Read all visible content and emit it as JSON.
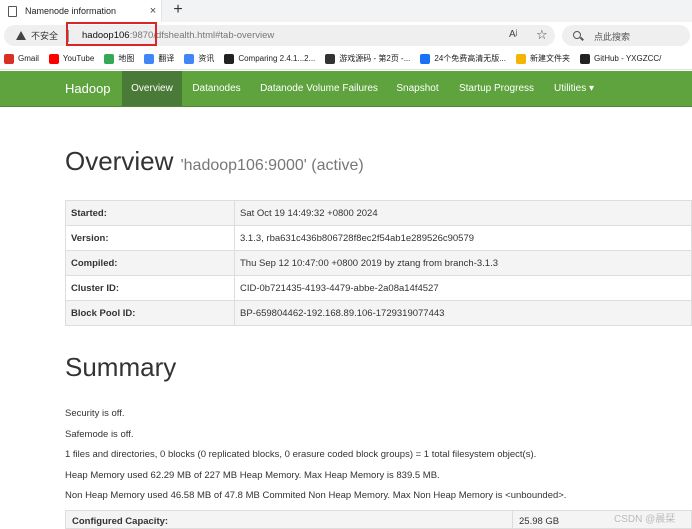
{
  "browser": {
    "tab_title": "Namenode information",
    "tab_close": "×",
    "new_tab": "+",
    "security_label": "不安全",
    "url_host": "hadoop106",
    "url_rest": ":9870/dfshealth.html#tab-overview",
    "read_aloud": "Aʲ",
    "favorite": "☆",
    "search_placeholder": "点此搜索"
  },
  "bookmarks": [
    {
      "label": "Gmail",
      "icon": "gmail-icon",
      "color": "#d93025"
    },
    {
      "label": "YouTube",
      "icon": "youtube-icon",
      "color": "#ff0000"
    },
    {
      "label": "地图",
      "icon": "maps-icon",
      "color": "#34a853"
    },
    {
      "label": "翻译",
      "icon": "translate-icon",
      "color": "#4285f4"
    },
    {
      "label": "资讯",
      "icon": "news-icon",
      "color": "#4285f4"
    },
    {
      "label": "Comparing 2.4.1...2...",
      "icon": "github-icon",
      "color": "#222222"
    },
    {
      "label": "游戏源码 - 第2页 -...",
      "icon": "game-site-icon",
      "color": "#333333"
    },
    {
      "label": "24个免费高清无版...",
      "icon": "zhihu-icon",
      "color": "#1772f6"
    },
    {
      "label": "新建文件夹",
      "icon": "folder-icon",
      "color": "#f4b400"
    },
    {
      "label": "GitHub - YXGZCC/",
      "icon": "github-icon",
      "color": "#222222"
    }
  ],
  "navbar": {
    "brand": "Hadoop",
    "items": [
      {
        "label": "Overview",
        "active": true
      },
      {
        "label": "Datanodes",
        "active": false
      },
      {
        "label": "Datanode Volume Failures",
        "active": false
      },
      {
        "label": "Snapshot",
        "active": false
      },
      {
        "label": "Startup Progress",
        "active": false
      },
      {
        "label": "Utilities ▾",
        "active": false
      }
    ],
    "color": "#5fa33e"
  },
  "overview": {
    "title": "Overview",
    "subtitle": "'hadoop106:9000' (active)",
    "rows": [
      {
        "key": "Started:",
        "value": "Sat Oct 19 14:49:32 +0800 2024"
      },
      {
        "key": "Version:",
        "value": "3.1.3, rba631c436b806728f8ec2f54ab1e289526c90579"
      },
      {
        "key": "Compiled:",
        "value": "Thu Sep 12 10:47:00 +0800 2019 by ztang from branch-3.1.3"
      },
      {
        "key": "Cluster ID:",
        "value": "CID-0b721435-4193-4479-abbe-2a08a14f4527"
      },
      {
        "key": "Block Pool ID:",
        "value": "BP-659804462-192.168.89.106-1729319077443"
      }
    ]
  },
  "summary": {
    "title": "Summary",
    "lines": [
      "Security is off.",
      "Safemode is off.",
      "1 files and directories, 0 blocks (0 replicated blocks, 0 erasure coded block groups) = 1 total filesystem object(s).",
      "Heap Memory used 62.29 MB of 227 MB Heap Memory. Max Heap Memory is 839.5 MB.",
      "Non Heap Memory used 46.58 MB of 47.8 MB Commited Non Heap Memory. Max Non Heap Memory is <unbounded>."
    ],
    "capacity_key": "Configured Capacity:",
    "capacity_value": "25.98 GB"
  },
  "watermark": "CSDN @晨栞"
}
